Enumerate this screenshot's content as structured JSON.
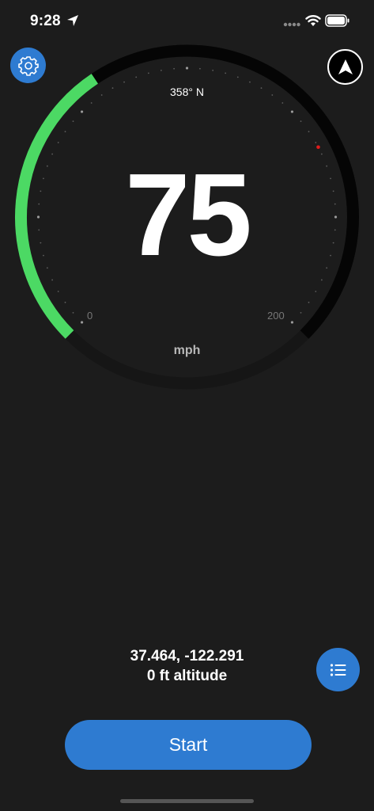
{
  "status_bar": {
    "time": "9:28"
  },
  "gauge": {
    "heading": "358° N",
    "speed": "75",
    "unit": "mph",
    "min_label": "0",
    "max_label": "200",
    "accent_color": "#4cd964",
    "needle_marker_color": "#e21b1b"
  },
  "location": {
    "coordinates": "37.464, -122.291",
    "altitude": "0 ft altitude"
  },
  "actions": {
    "start_label": "Start"
  },
  "colors": {
    "primary": "#2e7bd1",
    "background": "#1c1c1c"
  },
  "icons": {
    "settings": "gear-icon",
    "compass": "navigation-arrow-icon",
    "list": "list-icon"
  }
}
